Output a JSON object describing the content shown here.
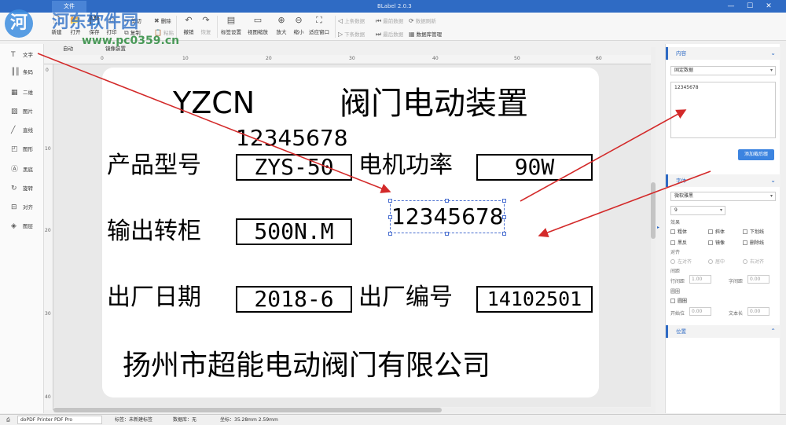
{
  "titlebar": {
    "file_tab": "文件",
    "app_title": "BLabel 2.0.3",
    "min": "—",
    "max": "☐",
    "close": "✕"
  },
  "watermark": {
    "text": "河东软件园",
    "url": "www.pc0359.cn",
    "logo": "河"
  },
  "ribbon": {
    "new": "新建",
    "open": "打开",
    "save": "保存",
    "print": "打印",
    "cut": "剪切",
    "copy": "复制",
    "paste": "粘贴",
    "delete": "删除",
    "auto": "自动",
    "mirror": "镜像装置",
    "undo": "撤销",
    "redo": "恢复",
    "label_settings": "标签设置",
    "view_zoom": "视图缩放",
    "zoom_in": "放大",
    "zoom_out": "缩小",
    "fit_window": "适应窗口",
    "prev_record": "上条数据",
    "next_record": "下条数据",
    "latest_record": "最前数据",
    "last_record": "最后数据",
    "refresh_data": "数据刷新",
    "db_manage": "数据库管理"
  },
  "tools": [
    "文字",
    "条码",
    "二维",
    "图片",
    "直线",
    "图形",
    "黑底",
    "旋转",
    "对齐",
    "图层"
  ],
  "ruler": {
    "h": [
      "0",
      "10",
      "20",
      "30",
      "40",
      "50",
      "60"
    ],
    "v": [
      "0",
      "10",
      "20",
      "30",
      "40"
    ]
  },
  "label": {
    "brand": "YZCN",
    "product_title": "阀门电动装置",
    "top_number": "12345678",
    "model_label": "产品型号",
    "model_value": "ZYS-50",
    "power_label": "电机功率",
    "power_value": "90W",
    "selected_text": "12345678",
    "torque_label": "输出转柜",
    "torque_value": "500N.M",
    "date_label": "出厂日期",
    "date_value": "2018-6",
    "serial_label": "出厂编号",
    "serial_value": "14102501",
    "company": "扬州市超能电动阀门有限公司"
  },
  "panel": {
    "content": {
      "title": "内容",
      "source": "固定数据",
      "text": "12345678",
      "add_button": "添加截后缀"
    },
    "font": {
      "title": "字体",
      "family": "微软雅黑",
      "size": "9",
      "effects_label": "效果",
      "bold": "粗体",
      "italic": "斜体",
      "underline": "下划线",
      "invert": "黑反",
      "mirror": "镜像",
      "strike": "删除线",
      "align_label": "对齐",
      "left": "左对齐",
      "center": "居中",
      "right": "右对齐",
      "spacing_label": "间距",
      "line_spacing": "行间距",
      "line_spacing_value": "1.00",
      "char_spacing": "字间距",
      "char_spacing_value": "0.00",
      "arc_label": "圆圈",
      "arc": "圆圈",
      "start_angle": "开始位",
      "start_angle_value": "0.00",
      "text_length": "文本长",
      "text_length_value": "0.00"
    },
    "position": {
      "title": "位置"
    }
  },
  "status": {
    "printer": "doPDF Printer PDF Pro",
    "label_name": "标签：未新建标签",
    "database": "数据库：无",
    "coords": "坐标：35.28mm 2.59mm"
  },
  "colors": {
    "accent": "#2f6bc4",
    "arrow": "#d32a2a"
  }
}
